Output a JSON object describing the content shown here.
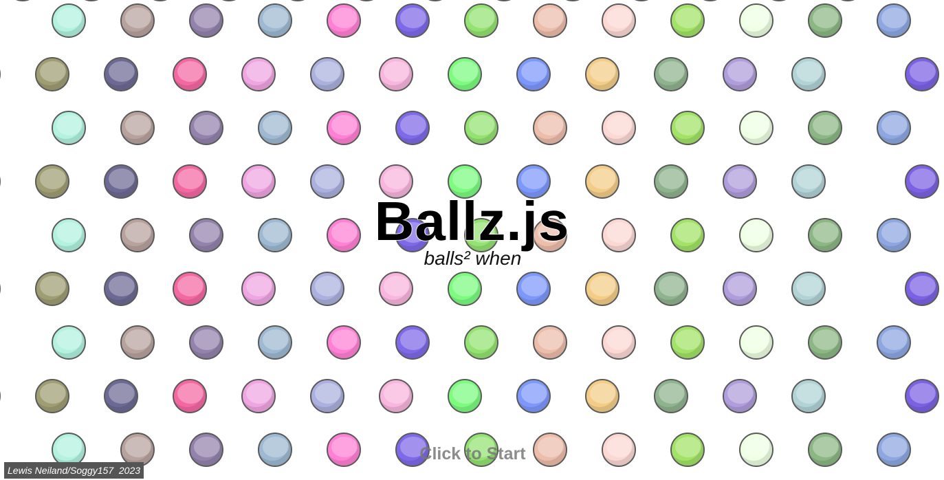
{
  "game": {
    "title": "Ballz.js",
    "subtitle": "balls² when",
    "start_prompt": "Click to Start",
    "credit": "Lewis Neiland/Soggy157  2023"
  },
  "ball_rows": {
    "odd_row_colors": [
      "#b2f2df",
      "#b8a29e",
      "#9383ac",
      "#9fb9d2",
      "#ff80d4",
      "#7e69e8",
      "#94e271",
      "#ecbdab",
      "#fcd8d4",
      "#a2e266",
      "#eeffe3",
      "#8cb784",
      "#8ea7e1"
    ],
    "even_row_colors": [
      "#e6c5c7",
      "#9f9e73",
      "#6c6a94",
      "#f468a2",
      "#efa5e1",
      "#abb0de",
      "#f8b5dd",
      "#7cfb7f",
      "#7d98fb",
      "#f3cd87",
      "#8fb38f",
      "#b09ddc",
      "#b1d3d6",
      "#ffffff",
      "#7c62e3"
    ]
  }
}
